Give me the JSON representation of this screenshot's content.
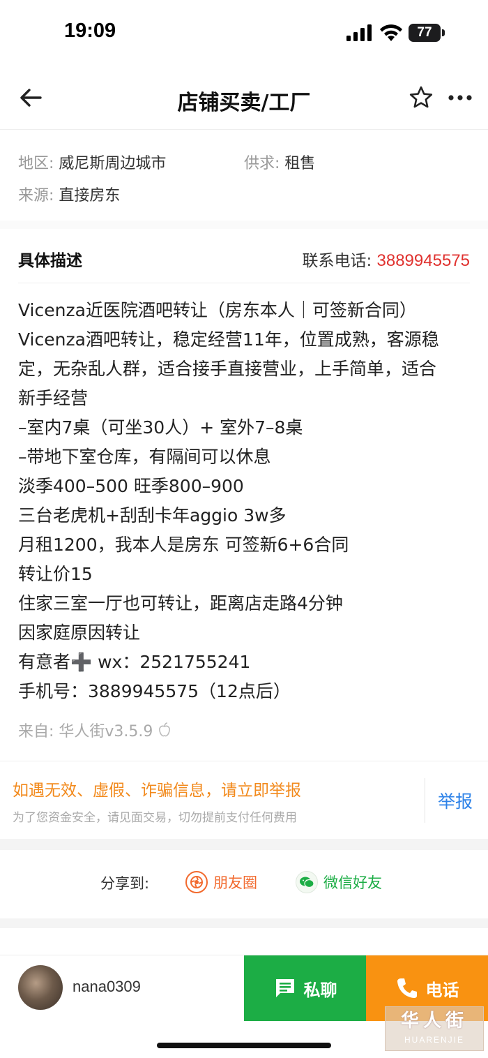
{
  "status_bar": {
    "time": "19:09",
    "battery": "77"
  },
  "nav": {
    "title": "店铺买卖/工厂"
  },
  "info": {
    "region_label": "地区:",
    "region_value": "威尼斯周边城市",
    "demand_label": "供求:",
    "demand_value": "租售",
    "source_label": "来源:",
    "source_value": "直接房东"
  },
  "description": {
    "title": "具体描述",
    "contact_label": "联系电话:",
    "contact_phone": "3889945575",
    "lines": [
      "Vicenza近医院酒吧转让（房东本人｜可签新合同）",
      "Vicenza酒吧转让，稳定经营11年，位置成熟，客源稳",
      "定，无杂乱人群，适合接手直接营业，上手简单，适合",
      "新手经营",
      "–室内7桌（可坐30人）+ 室外7–8桌",
      "–带地下室仓库，有隔间可以休息",
      "淡季400–500 旺季800–900",
      "三台老虎机+刮刮卡年aggio 3w多",
      "月租1200，我本人是房东 可签新6+6合同",
      "转让价15",
      "住家三室一厅也可转让，距离店走路4分钟",
      "因家庭原因转让",
      "有意者➕ wx：2521755241",
      "手机号：3889945575（12点后）"
    ],
    "from": "来自: 华人街v3.5.9"
  },
  "report": {
    "warning": "如遇无效、虚假、诈骗信息，请立即举报",
    "sub": "为了您资金安全，请见面交易，切勿提前支付任何费用",
    "button": "举报"
  },
  "share": {
    "label": "分享到:",
    "moments": "朋友圈",
    "wechat": "微信好友"
  },
  "bottom_bar": {
    "username": "nana0309",
    "chat": "私聊",
    "call": "电话"
  },
  "watermark": {
    "cn": "华人街",
    "en": "HUARENJIE"
  },
  "colors": {
    "accent_red": "#e0322f",
    "chat_green": "#1cad45",
    "call_orange": "#f99211",
    "report_blue": "#2d82e8",
    "warning_orange": "#f28a1d"
  }
}
